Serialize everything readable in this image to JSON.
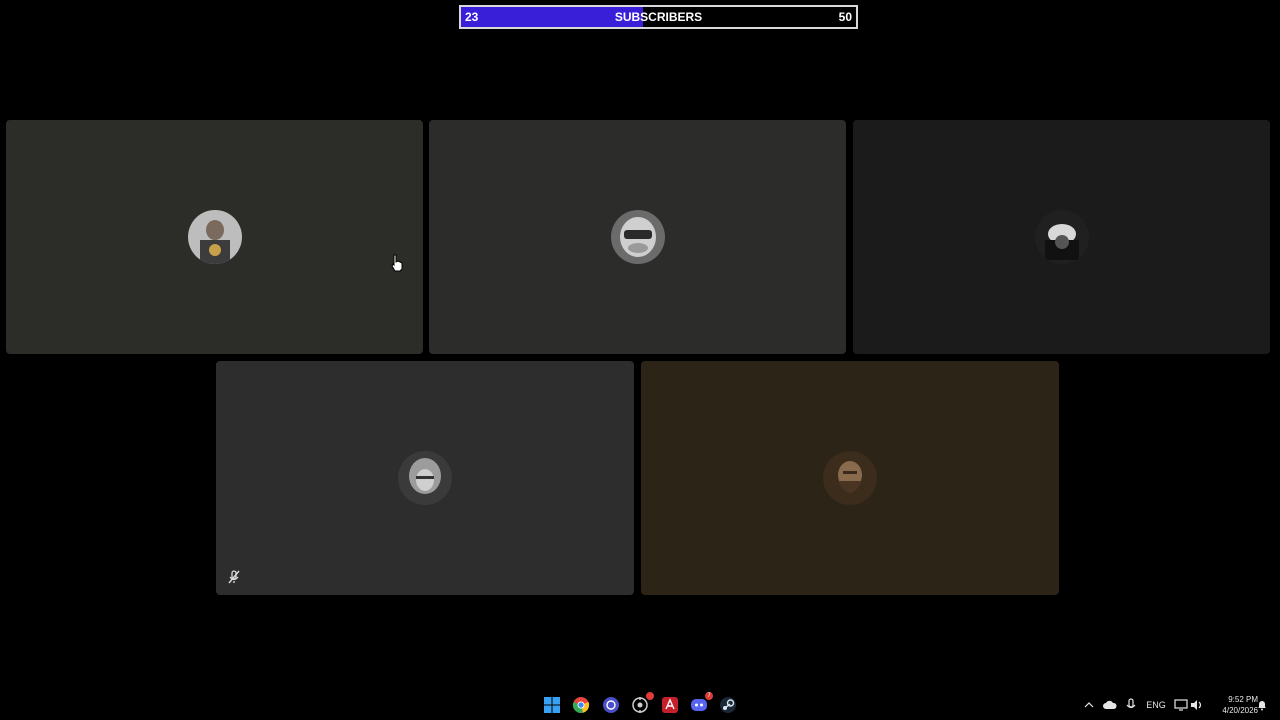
{
  "subscriber_goal": {
    "current": "23",
    "label": "SUBSCRIBERS",
    "goal": "50",
    "progress_fraction": 0.46,
    "fill_color": "#3a1fd9"
  },
  "participants": [
    {
      "tile_color": "#2c2d29",
      "avatar": "participant-avatar"
    },
    {
      "tile_color": "#2c2d2a",
      "avatar": "participant-avatar"
    },
    {
      "tile_color": "#1a1b1a",
      "avatar": "participant-avatar"
    },
    {
      "tile_color": "#2d2d2d",
      "avatar": "participant-avatar",
      "muted_icon": "microphone-muted-icon"
    },
    {
      "tile_color": "#2b2417",
      "avatar": "participant-avatar"
    }
  ],
  "taskbar": {
    "apps": [
      {
        "icon": "windows-start-icon"
      },
      {
        "icon": "chrome-icon"
      },
      {
        "icon": "obs-icon"
      },
      {
        "icon": "gear-app-icon"
      },
      {
        "icon": "acrobat-icon"
      },
      {
        "icon": "discord-icon",
        "badge": "7"
      },
      {
        "icon": "steam-icon"
      }
    ],
    "tray": {
      "language": "ENG",
      "time": "9:52 PM",
      "date": "4/20/2026"
    }
  }
}
